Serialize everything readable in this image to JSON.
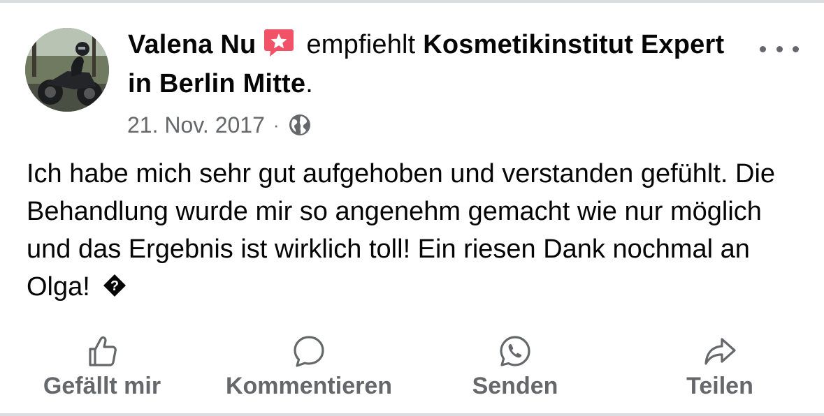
{
  "post": {
    "author": "Valena Nu",
    "verb": "empfiehlt",
    "page_name": "Kosmetikinstitut Expert in Berlin Mitte",
    "page_suffix": ".",
    "date": "21. Nov. 2017",
    "separator": "·",
    "audience_icon": "globe-icon",
    "badge_icon": "recommendation-star-icon",
    "body": "Ich habe mich sehr gut aufgehoben und verstanden gefühlt. Die Behandlung wurde mir so angenehm gemacht wie nur möglich und das Ergebnis ist wirklich toll! Ein riesen Dank nochmal an Olga!",
    "trailing_glyph": "?"
  },
  "actions": {
    "like": "Gefällt mir",
    "comment": "Kommentieren",
    "send": "Senden",
    "share": "Teilen"
  },
  "colors": {
    "text": "#050505",
    "secondary": "#65676b",
    "badge": "#f25268",
    "divider": "#dcdde1"
  }
}
